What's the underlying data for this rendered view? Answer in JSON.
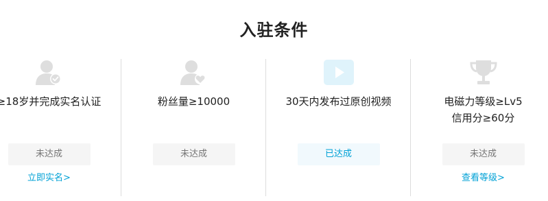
{
  "page": {
    "title": "入驻条件"
  },
  "conditions": [
    {
      "icon": "verified-user-icon",
      "requirement": "≥18岁并完成实名认证",
      "status": "未达成",
      "link": "立即实名>"
    },
    {
      "icon": "fans-heart-user-icon",
      "requirement": "粉丝量≥10000",
      "status": "未达成"
    },
    {
      "icon": "video-play-icon",
      "requirement": "30天内发布过原创视频",
      "status": "已达成"
    },
    {
      "icon": "trophy-icon",
      "requirement": "电磁力等级≥Lv5",
      "requirement_line2": "信用分≥60分",
      "status": "未达成",
      "link": "查看等级>"
    }
  ],
  "colors": {
    "accent": "#00a1d6",
    "icon_gray": "#dedede",
    "icon_blue": "#dff3fb",
    "done_bg": "#f1f9fd",
    "pending_bg": "#f5f5f5"
  }
}
